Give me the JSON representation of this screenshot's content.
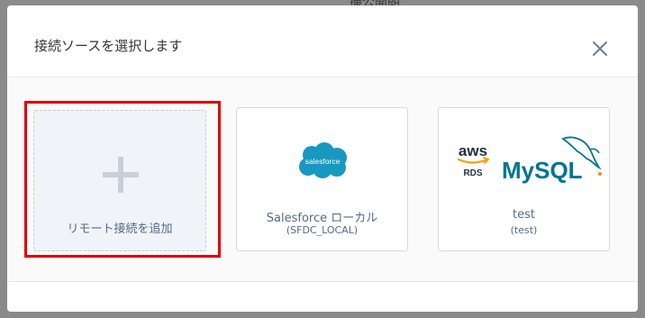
{
  "backdrop": {
    "partial_text": "撮公開朗"
  },
  "modal": {
    "title": "接続ソースを選択します",
    "close_icon": "close-icon"
  },
  "cards": {
    "add": {
      "label": "リモート接続を追加",
      "icon": "plus-icon"
    },
    "salesforce": {
      "logo_text": "salesforce",
      "label": "Salesforce ローカル",
      "sub": "(SFDC_LOCAL)",
      "logo_color": "#1798c1"
    },
    "test": {
      "aws_text": "aws",
      "rds_text": "RDS",
      "mysql_text": "MySQL",
      "label": "test",
      "sub": "(test)"
    }
  },
  "colors": {
    "accent_red": "#e10000",
    "card_text": "#54698d",
    "mysql_blue": "#00758f",
    "mysql_orange": "#f29111",
    "aws_orange": "#ff9900"
  }
}
